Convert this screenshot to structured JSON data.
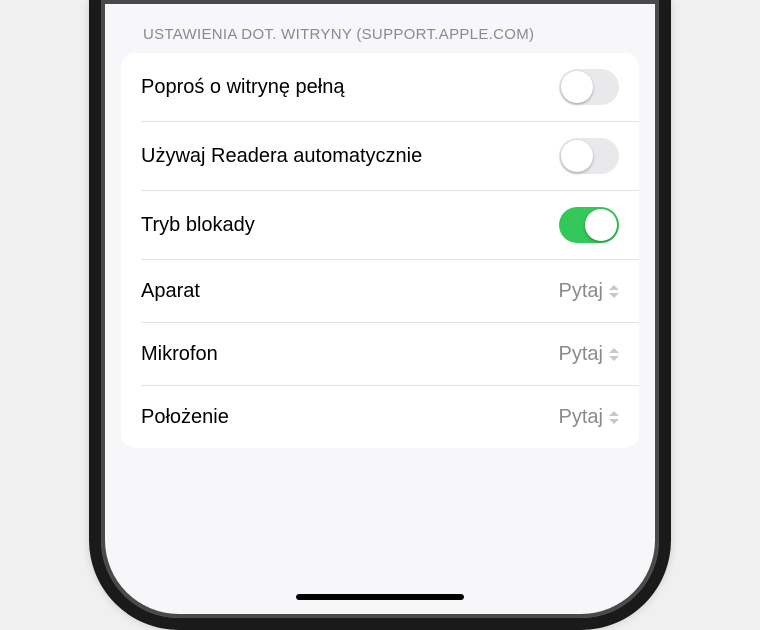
{
  "section_title": "USTAWIENIA DOT. WITRYNY (SUPPORT.APPLE.COM)",
  "rows": {
    "desktop": {
      "label": "Poproś o witrynę pełną",
      "on": false
    },
    "reader": {
      "label": "Używaj Readera automatycznie",
      "on": false
    },
    "lockdown": {
      "label": "Tryb blokady",
      "on": true
    },
    "camera": {
      "label": "Aparat",
      "value": "Pytaj"
    },
    "mic": {
      "label": "Mikrofon",
      "value": "Pytaj"
    },
    "location": {
      "label": "Położenie",
      "value": "Pytaj"
    }
  },
  "colors": {
    "toggle_on": "#34c759"
  }
}
